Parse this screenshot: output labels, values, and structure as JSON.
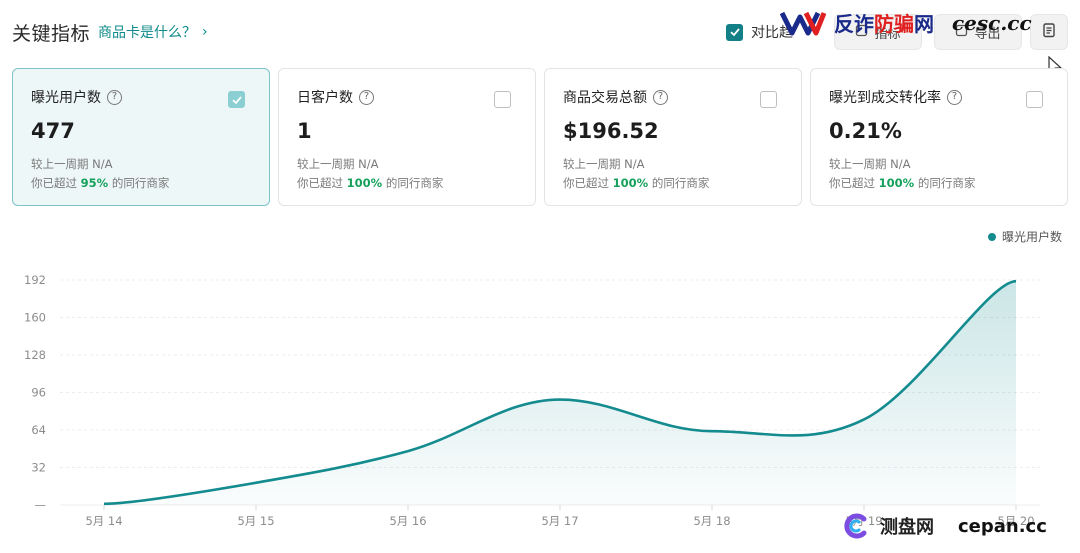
{
  "header": {
    "title": "关键指标",
    "help_link": "商品卡是什么？",
    "help_chevron": "›"
  },
  "toolbar": {
    "compare_label": "对比趋",
    "btn_a_label": "指标",
    "btn_b_label": "导出"
  },
  "watermarks": {
    "top_cn_a": "反诈",
    "top_cn_b": "防骗",
    "top_cn_c": "网",
    "top_site": "cesc.cc",
    "bottom_cn": "测盘网",
    "bottom_site": "cepan.cc"
  },
  "cards": [
    {
      "title": "曝光用户数",
      "value": "477",
      "compare": "较上一周期 N/A",
      "beat_prefix": "你已超过 ",
      "beat_pct": "95%",
      "beat_suffix": " 的同行商家",
      "checked": true
    },
    {
      "title": "日客户数",
      "value": "1",
      "compare": "较上一周期 N/A",
      "beat_prefix": "你已超过 ",
      "beat_pct": "100%",
      "beat_suffix": " 的同行商家",
      "checked": false
    },
    {
      "title": "商品交易总额",
      "value": "$196.52",
      "compare": "较上一周期 N/A",
      "beat_prefix": "你已超过 ",
      "beat_pct": "100%",
      "beat_suffix": " 的同行商家",
      "checked": false
    },
    {
      "title": "曝光到成交转化率",
      "value": "0.21%",
      "compare": "较上一周期 N/A",
      "beat_prefix": "你已超过 ",
      "beat_pct": "100%",
      "beat_suffix": " 的同行商家",
      "checked": false
    }
  ],
  "colors": {
    "accent": "#138b8f",
    "positive": "#14a05a"
  },
  "chart_data": {
    "type": "area",
    "x": [
      "5月 14",
      "5月 15",
      "5月 16",
      "5月 17",
      "5月 18",
      "5月 19",
      "5月 20"
    ],
    "series": [
      {
        "name": "曝光用户数",
        "values": [
          1,
          19,
          46,
          90,
          63,
          73,
          191
        ]
      }
    ],
    "yticks": [
      0,
      32,
      64,
      96,
      128,
      160,
      192
    ],
    "ytick_labels": [
      "—",
      "32",
      "64",
      "96",
      "128",
      "160",
      "192"
    ],
    "ylim": [
      0,
      192
    ],
    "grid": true,
    "legend": "top-right",
    "title": "",
    "xlabel": "",
    "ylabel": ""
  }
}
